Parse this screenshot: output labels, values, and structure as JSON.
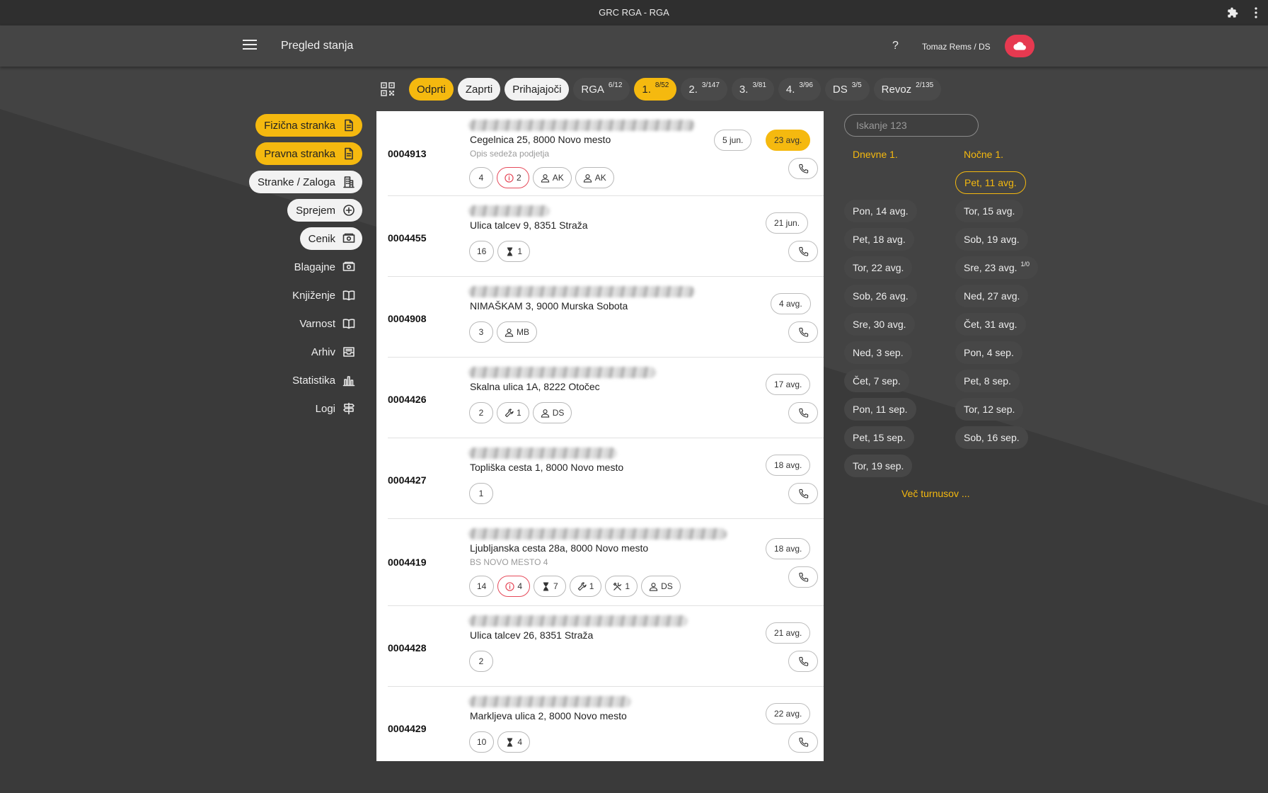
{
  "window": {
    "title": "GRC RGA - RGA"
  },
  "appbar": {
    "title": "Pregled stanja",
    "help": "?",
    "user": "Tomaz Rems / DS"
  },
  "filters": [
    {
      "label": "Odprti",
      "count": "",
      "style": "yellow"
    },
    {
      "label": "Zaprti",
      "count": "",
      "style": "white"
    },
    {
      "label": "Prihajajoči",
      "count": "",
      "style": "white"
    },
    {
      "label": "RGA",
      "count": "6/12",
      "style": "dark"
    },
    {
      "label": "1.",
      "count": "8/52",
      "style": "yellow"
    },
    {
      "label": "2.",
      "count": "3/147",
      "style": "dark"
    },
    {
      "label": "3.",
      "count": "3/81",
      "style": "dark"
    },
    {
      "label": "4.",
      "count": "3/96",
      "style": "dark"
    },
    {
      "label": "DS",
      "count": "3/5",
      "style": "dark"
    },
    {
      "label": "Revoz",
      "count": "2/135",
      "style": "dark"
    }
  ],
  "nav": [
    {
      "label": "Fizična stranka",
      "icon": "document-icon",
      "style": "yellow"
    },
    {
      "label": "Pravna stranka",
      "icon": "document-icon",
      "style": "yellow"
    },
    {
      "label": "Stranke / Zaloga",
      "icon": "building-icon",
      "style": "white"
    },
    {
      "label": "Sprejem",
      "icon": "plus-circle-icon",
      "style": "white"
    },
    {
      "label": "Cenik",
      "icon": "money-icon",
      "style": "white"
    },
    {
      "label": "Blagajne",
      "icon": "money-icon",
      "style": "plain"
    },
    {
      "label": "Knjiženje",
      "icon": "book-icon",
      "style": "plain"
    },
    {
      "label": "Varnost",
      "icon": "book-icon",
      "style": "plain"
    },
    {
      "label": "Arhiv",
      "icon": "inbox-icon",
      "style": "plain"
    },
    {
      "label": "Statistika",
      "icon": "bar-chart-icon",
      "style": "plain"
    },
    {
      "label": "Logi",
      "icon": "signpost-icon",
      "style": "plain"
    }
  ],
  "records": [
    {
      "id": "0004913",
      "address": "Cegelnica 25, 8000 Novo mesto",
      "sub": "Opis sedeža podjetja",
      "dates": [
        {
          "label": "5 jun.",
          "style": "plain"
        },
        {
          "label": "23 avg.",
          "style": "yellow"
        }
      ],
      "tags": [
        {
          "icon": "",
          "text": "4"
        },
        {
          "icon": "info-icon",
          "text": "2",
          "red": true
        },
        {
          "icon": "person-icon",
          "text": "AK"
        },
        {
          "icon": "person-icon",
          "text": "AK"
        }
      ]
    },
    {
      "id": "0004455",
      "address": "Ulica talcev 9, 8351 Straža",
      "sub": "",
      "dates": [
        {
          "label": "21 jun.",
          "style": "plain"
        }
      ],
      "tags": [
        {
          "icon": "",
          "text": "16"
        },
        {
          "icon": "hourglass-icon",
          "text": "1"
        }
      ]
    },
    {
      "id": "0004908",
      "address": "NIMAŠKAM 3, 9000 Murska Sobota",
      "sub": "",
      "dates": [
        {
          "label": "4 avg.",
          "style": "plain"
        }
      ],
      "tags": [
        {
          "icon": "",
          "text": "3"
        },
        {
          "icon": "person-icon",
          "text": "MB"
        }
      ]
    },
    {
      "id": "0004426",
      "address": "Skalna ulica 1A, 8222 Otočec",
      "sub": "",
      "dates": [
        {
          "label": "17 avg.",
          "style": "plain"
        }
      ],
      "tags": [
        {
          "icon": "",
          "text": "2"
        },
        {
          "icon": "wrench-icon",
          "text": "1"
        },
        {
          "icon": "person-icon",
          "text": "DS"
        }
      ]
    },
    {
      "id": "0004427",
      "address": "Topliška cesta 1, 8000 Novo mesto",
      "sub": "",
      "dates": [
        {
          "label": "18 avg.",
          "style": "plain"
        }
      ],
      "tags": [
        {
          "icon": "",
          "text": "1"
        }
      ]
    },
    {
      "id": "0004419",
      "address": "Ljubljanska cesta 28a, 8000 Novo mesto",
      "sub": "BS NOVO MESTO 4",
      "dates": [
        {
          "label": "18 avg.",
          "style": "plain"
        }
      ],
      "tags": [
        {
          "icon": "",
          "text": "14"
        },
        {
          "icon": "info-icon",
          "text": "4",
          "red": true
        },
        {
          "icon": "hourglass-icon",
          "text": "7"
        },
        {
          "icon": "wrench-icon",
          "text": "1"
        },
        {
          "icon": "tools-icon",
          "text": "1"
        },
        {
          "icon": "person-icon",
          "text": "DS"
        }
      ]
    },
    {
      "id": "0004428",
      "address": "Ulica talcev 26, 8351 Straža",
      "sub": "",
      "dates": [
        {
          "label": "21 avg.",
          "style": "plain"
        }
      ],
      "tags": [
        {
          "icon": "",
          "text": "2"
        }
      ]
    },
    {
      "id": "0004429",
      "address": "Markljeva ulica 2, 8000 Novo mesto",
      "sub": "",
      "dates": [
        {
          "label": "22 avg.",
          "style": "plain"
        }
      ],
      "tags": [
        {
          "icon": "",
          "text": "10"
        },
        {
          "icon": "hourglass-icon",
          "text": "4"
        }
      ]
    }
  ],
  "shifts": {
    "search_placeholder": "Iskanje 123",
    "day_header": "Dnevne 1.",
    "night_header": "Nočne 1.",
    "day": [
      {
        "label": "Pon, 14 avg.",
        "count": ""
      },
      {
        "label": "Pet, 18 avg.",
        "count": ""
      },
      {
        "label": "Tor, 22 avg.",
        "count": ""
      },
      {
        "label": "Sob, 26 avg.",
        "count": ""
      },
      {
        "label": "Sre, 30 avg.",
        "count": ""
      },
      {
        "label": "Ned, 3 sep.",
        "count": ""
      },
      {
        "label": "Čet, 7 sep.",
        "count": ""
      },
      {
        "label": "Pon, 11 sep.",
        "count": ""
      },
      {
        "label": "Pet, 15 sep.",
        "count": ""
      },
      {
        "label": "Tor, 19 sep.",
        "count": ""
      }
    ],
    "night": [
      {
        "label": "Pet, 11 avg.",
        "count": "",
        "active": true
      },
      {
        "label": "Tor, 15 avg.",
        "count": ""
      },
      {
        "label": "Sob, 19 avg.",
        "count": ""
      },
      {
        "label": "Sre, 23 avg.",
        "count": "1/0"
      },
      {
        "label": "Ned, 27 avg.",
        "count": ""
      },
      {
        "label": "Čet, 31 avg.",
        "count": ""
      },
      {
        "label": "Pon, 4 sep.",
        "count": ""
      },
      {
        "label": "Pet, 8 sep.",
        "count": ""
      },
      {
        "label": "Tor, 12 sep.",
        "count": ""
      },
      {
        "label": "Sob, 16 sep.",
        "count": ""
      }
    ],
    "more": "Več turnusov ..."
  },
  "colors": {
    "accent": "#f5b90f",
    "danger": "#e63950",
    "background": "#3a3a3a"
  }
}
